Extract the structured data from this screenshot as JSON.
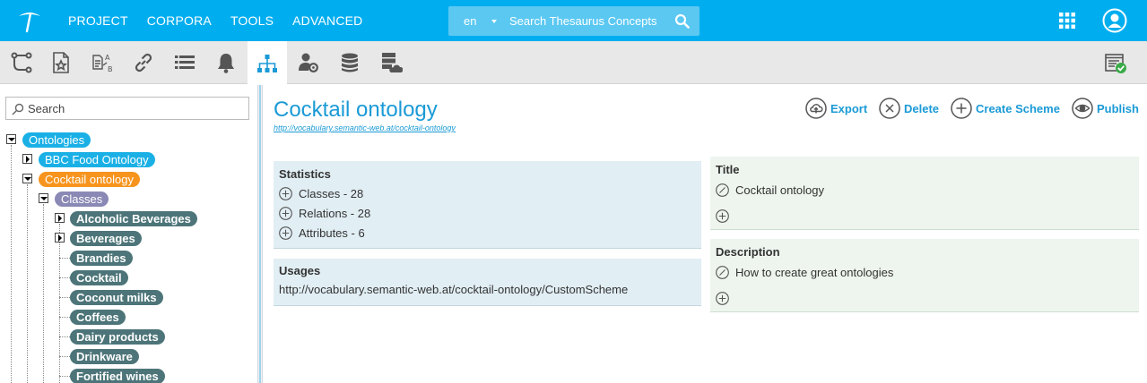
{
  "topbar": {
    "menu": [
      "PROJECT",
      "CORPORA",
      "TOOLS",
      "ADVANCED"
    ],
    "language": "en",
    "search_placeholder": "Search Thesaurus Concepts"
  },
  "toolbar": {
    "icons": [
      "hierarchy-flow-icon",
      "starred-document-icon",
      "translate-ab-icon",
      "link-icon",
      "list-icon",
      "bell-icon",
      "org-chart-icon",
      "user-settings-icon",
      "database-icon",
      "server-cloud-icon",
      "report-check-icon"
    ],
    "active": "org-chart-icon"
  },
  "tree": {
    "search_placeholder": "Search",
    "root": "Ontologies",
    "items": [
      "BBC Food Ontology",
      "Cocktail ontology"
    ],
    "classes_label": "Classes",
    "classes": [
      "Alcoholic Beverages",
      "Beverages",
      "Brandies",
      "Cocktail",
      "Coconut milks",
      "Coffees",
      "Dairy products",
      "Drinkware",
      "Fortified wines"
    ]
  },
  "main": {
    "title": "Cocktail ontology",
    "uri": "http://vocabulary.semantic-web.at/cocktail-ontology",
    "actions": {
      "export": "Export",
      "delete": "Delete",
      "create_scheme": "Create Scheme",
      "publish": "Publish"
    },
    "statistics": {
      "heading": "Statistics",
      "items": [
        "Classes - 28",
        "Relations - 28",
        "Attributes - 6"
      ]
    },
    "usages": {
      "heading": "Usages",
      "value": "http://vocabulary.semantic-web.at/cocktail-ontology/CustomScheme"
    },
    "title_panel": {
      "heading": "Title",
      "value": "Cocktail ontology"
    },
    "description_panel": {
      "heading": "Description",
      "value": "How to create great ontologies"
    }
  },
  "colors": {
    "brand": "#00aeef",
    "link": "#1a9ad6",
    "node_blue": "#1ab0e6",
    "node_orange": "#f7941d",
    "node_purple": "#8a89b5",
    "node_teal": "#4d7579"
  }
}
